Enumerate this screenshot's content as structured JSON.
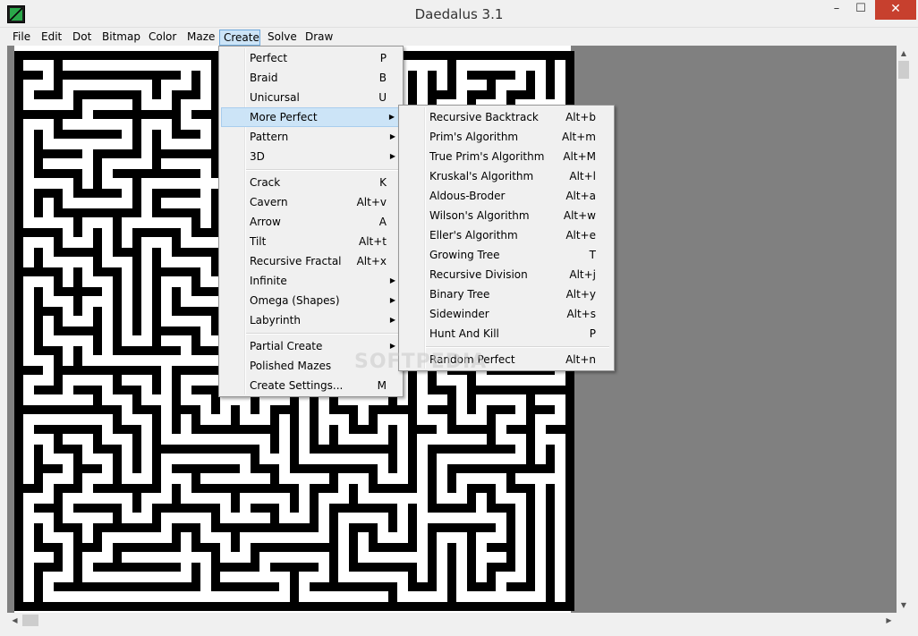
{
  "window": {
    "title": "Daedalus 3.1",
    "minimize": "–",
    "maximize": "☐",
    "close": "✕"
  },
  "menubar": [
    "File",
    "Edit",
    "Dot",
    "Bitmap",
    "Color",
    "Maze",
    "Create",
    "Solve",
    "Draw"
  ],
  "create_menu": [
    {
      "label": "Perfect",
      "shortcut": "P"
    },
    {
      "label": "Braid",
      "shortcut": "B"
    },
    {
      "label": "Unicursal",
      "shortcut": "U"
    },
    {
      "label": "More Perfect",
      "shortcut": "",
      "submenu": true
    },
    {
      "label": "Pattern",
      "shortcut": "",
      "submenu": true
    },
    {
      "label": "3D",
      "shortcut": "",
      "submenu": true
    },
    {
      "label": "Crack",
      "shortcut": "K"
    },
    {
      "label": "Cavern",
      "shortcut": "Alt+v"
    },
    {
      "label": "Arrow",
      "shortcut": "A"
    },
    {
      "label": "Tilt",
      "shortcut": "Alt+t"
    },
    {
      "label": "Recursive Fractal",
      "shortcut": "Alt+x"
    },
    {
      "label": "Infinite",
      "shortcut": "",
      "submenu": true
    },
    {
      "label": "Omega (Shapes)",
      "shortcut": "",
      "submenu": true
    },
    {
      "label": "Labyrinth",
      "shortcut": "",
      "submenu": true
    },
    {
      "label": "Partial Create",
      "shortcut": "",
      "submenu": true
    },
    {
      "label": "Polished Mazes",
      "shortcut": ""
    },
    {
      "label": "Create Settings...",
      "shortcut": "M"
    }
  ],
  "more_perfect_menu": [
    {
      "label": "Recursive Backtrack",
      "shortcut": "Alt+b"
    },
    {
      "label": "Prim's Algorithm",
      "shortcut": "Alt+m"
    },
    {
      "label": "True Prim's Algorithm",
      "shortcut": "Alt+M"
    },
    {
      "label": "Kruskal's Algorithm",
      "shortcut": "Alt+l"
    },
    {
      "label": "Aldous-Broder",
      "shortcut": "Alt+a"
    },
    {
      "label": "Wilson's Algorithm",
      "shortcut": "Alt+w"
    },
    {
      "label": "Eller's Algorithm",
      "shortcut": "Alt+e"
    },
    {
      "label": "Growing Tree",
      "shortcut": "T"
    },
    {
      "label": "Recursive Division",
      "shortcut": "Alt+j"
    },
    {
      "label": "Binary Tree",
      "shortcut": "Alt+y"
    },
    {
      "label": "Sidewinder",
      "shortcut": "Alt+s"
    },
    {
      "label": "Hunt And Kill",
      "shortcut": "P"
    },
    {
      "label": "Random Perfect",
      "shortcut": "Alt+n"
    }
  ],
  "watermark": "SOFTPEDIA",
  "colors": {
    "accent": "#cce4f7",
    "close": "#c7402e",
    "canvas": "#808080",
    "wall": "#000000",
    "passage": "#ffffff"
  }
}
